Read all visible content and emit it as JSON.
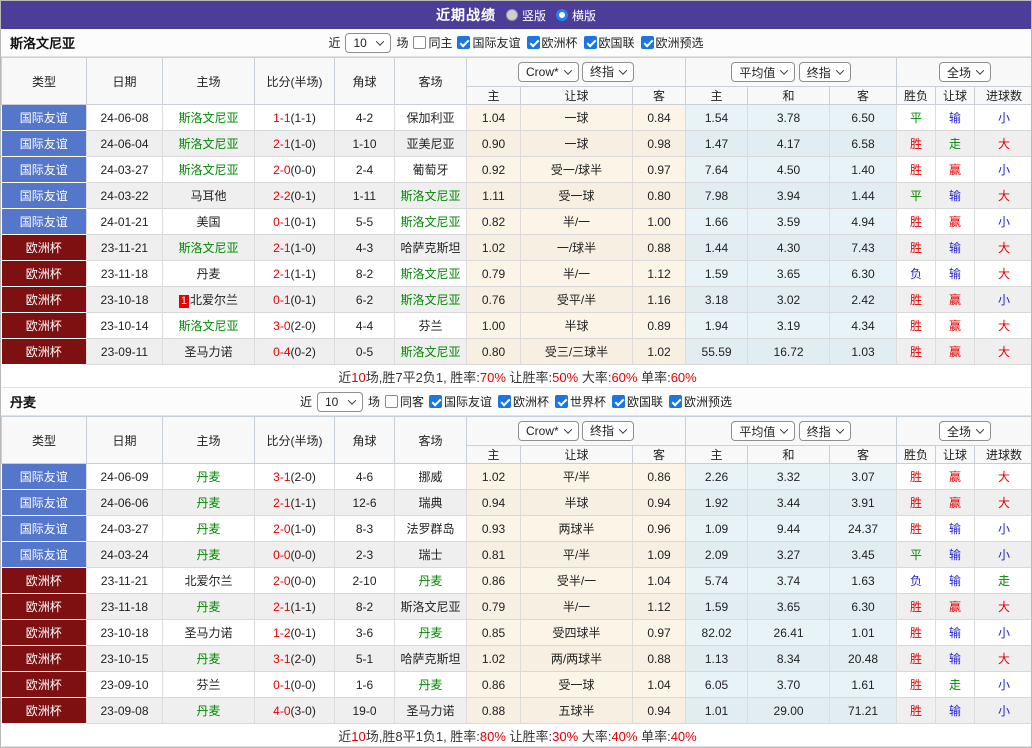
{
  "topbar": {
    "title": "近期战绩",
    "layout_options": [
      {
        "label": "竖版",
        "selected": false
      },
      {
        "label": "横版",
        "selected": true
      }
    ]
  },
  "colors": {
    "accent_purple": "#4b3d98",
    "badge_blue": "#5577cb",
    "badge_maroon": "#7e1012",
    "win_red": "#e60000",
    "loss_blue": "#2525cc",
    "draw_green": "#008800",
    "crow_column_bg": "#fbf4e7",
    "avg_column_bg": "#e8f3f7"
  },
  "table_header": {
    "static_cols": [
      "类型",
      "日期",
      "主场",
      "比分(半场)",
      "角球",
      "客场"
    ],
    "crow_group": {
      "select1": "Crow*",
      "select2": "终指",
      "sub": [
        "主",
        "让球",
        "客"
      ]
    },
    "avg_group": {
      "select1": "平均值",
      "select2": "终指",
      "sub": [
        "主",
        "和",
        "客"
      ]
    },
    "full_group": {
      "select": "全场",
      "sub": [
        "胜负",
        "让球",
        "进球数"
      ]
    }
  },
  "sections": [
    {
      "team": "斯洛文尼亚",
      "filter": {
        "prefix": "近",
        "count": "10",
        "suffix": "场",
        "same_venue_label": "同主",
        "same_venue_checked": false,
        "leagues": [
          "国际友谊",
          "欧洲杯",
          "欧国联",
          "欧洲预选"
        ]
      },
      "rows": [
        {
          "type": "国际友谊",
          "type_color": "blue",
          "date": "24-06-08",
          "home": "斯洛文尼亚",
          "home_green": true,
          "home_badge": "",
          "score": "1-1",
          "half": "(1-1)",
          "corner": "4-2",
          "away": "保加利亚",
          "away_green": false,
          "crow_home": "1.04",
          "handicap": "一球",
          "crow_away": "0.84",
          "avg_home": "1.54",
          "avg_draw": "3.78",
          "avg_away": "6.50",
          "result": "平",
          "result_c": "green",
          "hresult": "输",
          "hresult_c": "blue",
          "goals": "小",
          "goals_c": "blue"
        },
        {
          "type": "国际友谊",
          "type_color": "blue",
          "date": "24-06-04",
          "home": "斯洛文尼亚",
          "home_green": true,
          "home_badge": "",
          "score": "2-1",
          "half": "(1-0)",
          "corner": "1-10",
          "away": "亚美尼亚",
          "away_green": false,
          "crow_home": "0.90",
          "handicap": "一球",
          "crow_away": "0.98",
          "avg_home": "1.47",
          "avg_draw": "4.17",
          "avg_away": "6.58",
          "result": "胜",
          "result_c": "red",
          "hresult": "走",
          "hresult_c": "green",
          "goals": "大",
          "goals_c": "red"
        },
        {
          "type": "国际友谊",
          "type_color": "blue",
          "date": "24-03-27",
          "home": "斯洛文尼亚",
          "home_green": true,
          "home_badge": "",
          "score": "2-0",
          "half": "(0-0)",
          "corner": "2-4",
          "away": "葡萄牙",
          "away_green": false,
          "crow_home": "0.92",
          "handicap": "受一/球半",
          "crow_away": "0.97",
          "avg_home": "7.64",
          "avg_draw": "4.50",
          "avg_away": "1.40",
          "result": "胜",
          "result_c": "red",
          "hresult": "赢",
          "hresult_c": "red",
          "goals": "小",
          "goals_c": "blue"
        },
        {
          "type": "国际友谊",
          "type_color": "blue",
          "date": "24-03-22",
          "home": "马耳他",
          "home_green": false,
          "home_badge": "",
          "score": "2-2",
          "half": "(0-1)",
          "corner": "1-11",
          "away": "斯洛文尼亚",
          "away_green": true,
          "crow_home": "1.11",
          "handicap": "受一球",
          "crow_away": "0.80",
          "avg_home": "7.98",
          "avg_draw": "3.94",
          "avg_away": "1.44",
          "result": "平",
          "result_c": "green",
          "hresult": "输",
          "hresult_c": "blue",
          "goals": "大",
          "goals_c": "red"
        },
        {
          "type": "国际友谊",
          "type_color": "blue",
          "date": "24-01-21",
          "home": "美国",
          "home_green": false,
          "home_badge": "",
          "score": "0-1",
          "half": "(0-1)",
          "corner": "5-5",
          "away": "斯洛文尼亚",
          "away_green": true,
          "crow_home": "0.82",
          "handicap": "半/一",
          "crow_away": "1.00",
          "avg_home": "1.66",
          "avg_draw": "3.59",
          "avg_away": "4.94",
          "result": "胜",
          "result_c": "red",
          "hresult": "赢",
          "hresult_c": "red",
          "goals": "小",
          "goals_c": "blue"
        },
        {
          "type": "欧洲杯",
          "type_color": "maroon",
          "date": "23-11-21",
          "home": "斯洛文尼亚",
          "home_green": true,
          "home_badge": "",
          "score": "2-1",
          "half": "(1-0)",
          "corner": "4-3",
          "away": "哈萨克斯坦",
          "away_green": false,
          "crow_home": "1.02",
          "handicap": "一/球半",
          "crow_away": "0.88",
          "avg_home": "1.44",
          "avg_draw": "4.30",
          "avg_away": "7.43",
          "result": "胜",
          "result_c": "red",
          "hresult": "输",
          "hresult_c": "blue",
          "goals": "大",
          "goals_c": "red"
        },
        {
          "type": "欧洲杯",
          "type_color": "maroon",
          "date": "23-11-18",
          "home": "丹麦",
          "home_green": false,
          "home_badge": "",
          "score": "2-1",
          "half": "(1-1)",
          "corner": "8-2",
          "away": "斯洛文尼亚",
          "away_green": true,
          "crow_home": "0.79",
          "handicap": "半/一",
          "crow_away": "1.12",
          "avg_home": "1.59",
          "avg_draw": "3.65",
          "avg_away": "6.30",
          "result": "负",
          "result_c": "blue",
          "hresult": "输",
          "hresult_c": "blue",
          "goals": "大",
          "goals_c": "red"
        },
        {
          "type": "欧洲杯",
          "type_color": "maroon",
          "date": "23-10-18",
          "home": "北爱尔兰",
          "home_green": false,
          "home_badge": "1",
          "score": "0-1",
          "half": "(0-1)",
          "corner": "6-2",
          "away": "斯洛文尼亚",
          "away_green": true,
          "crow_home": "0.76",
          "handicap": "受平/半",
          "crow_away": "1.16",
          "avg_home": "3.18",
          "avg_draw": "3.02",
          "avg_away": "2.42",
          "result": "胜",
          "result_c": "red",
          "hresult": "赢",
          "hresult_c": "red",
          "goals": "小",
          "goals_c": "blue"
        },
        {
          "type": "欧洲杯",
          "type_color": "maroon",
          "date": "23-10-14",
          "home": "斯洛文尼亚",
          "home_green": true,
          "home_badge": "",
          "score": "3-0",
          "half": "(2-0)",
          "corner": "4-4",
          "away": "芬兰",
          "away_green": false,
          "crow_home": "1.00",
          "handicap": "半球",
          "crow_away": "0.89",
          "avg_home": "1.94",
          "avg_draw": "3.19",
          "avg_away": "4.34",
          "result": "胜",
          "result_c": "red",
          "hresult": "赢",
          "hresult_c": "red",
          "goals": "大",
          "goals_c": "red"
        },
        {
          "type": "欧洲杯",
          "type_color": "maroon",
          "date": "23-09-11",
          "home": "圣马力诺",
          "home_green": false,
          "home_badge": "",
          "score": "0-4",
          "half": "(0-2)",
          "corner": "0-5",
          "away": "斯洛文尼亚",
          "away_green": true,
          "crow_home": "0.80",
          "handicap": "受三/三球半",
          "crow_away": "1.02",
          "avg_home": "55.59",
          "avg_draw": "16.72",
          "avg_away": "1.03",
          "result": "胜",
          "result_c": "red",
          "hresult": "赢",
          "hresult_c": "red",
          "goals": "大",
          "goals_c": "red"
        }
      ],
      "summary": [
        {
          "t": "近"
        },
        {
          "t": "10",
          "red": true
        },
        {
          "t": "场,胜7平2负1, 胜率:"
        },
        {
          "t": "70%",
          "red": true
        },
        {
          "t": " 让胜率:"
        },
        {
          "t": "50%",
          "red": true
        },
        {
          "t": " 大率:"
        },
        {
          "t": "60%",
          "red": true
        },
        {
          "t": " 单率:"
        },
        {
          "t": "60%",
          "red": true
        }
      ]
    },
    {
      "team": "丹麦",
      "filter": {
        "prefix": "近",
        "count": "10",
        "suffix": "场",
        "same_venue_label": "同客",
        "same_venue_checked": false,
        "leagues": [
          "国际友谊",
          "欧洲杯",
          "世界杯",
          "欧国联",
          "欧洲预选"
        ]
      },
      "rows": [
        {
          "type": "国际友谊",
          "type_color": "blue",
          "date": "24-06-09",
          "home": "丹麦",
          "home_green": true,
          "home_badge": "",
          "score": "3-1",
          "half": "(2-0)",
          "corner": "4-6",
          "away": "挪威",
          "away_green": false,
          "crow_home": "1.02",
          "handicap": "平/半",
          "crow_away": "0.86",
          "avg_home": "2.26",
          "avg_draw": "3.32",
          "avg_away": "3.07",
          "result": "胜",
          "result_c": "red",
          "hresult": "赢",
          "hresult_c": "red",
          "goals": "大",
          "goals_c": "red"
        },
        {
          "type": "国际友谊",
          "type_color": "blue",
          "date": "24-06-06",
          "home": "丹麦",
          "home_green": true,
          "home_badge": "",
          "score": "2-1",
          "half": "(1-1)",
          "corner": "12-6",
          "away": "瑞典",
          "away_green": false,
          "crow_home": "0.94",
          "handicap": "半球",
          "crow_away": "0.94",
          "avg_home": "1.92",
          "avg_draw": "3.44",
          "avg_away": "3.91",
          "result": "胜",
          "result_c": "red",
          "hresult": "赢",
          "hresult_c": "red",
          "goals": "大",
          "goals_c": "red"
        },
        {
          "type": "国际友谊",
          "type_color": "blue",
          "date": "24-03-27",
          "home": "丹麦",
          "home_green": true,
          "home_badge": "",
          "score": "2-0",
          "half": "(1-0)",
          "corner": "8-3",
          "away": "法罗群岛",
          "away_green": false,
          "crow_home": "0.93",
          "handicap": "两球半",
          "crow_away": "0.96",
          "avg_home": "1.09",
          "avg_draw": "9.44",
          "avg_away": "24.37",
          "result": "胜",
          "result_c": "red",
          "hresult": "输",
          "hresult_c": "blue",
          "goals": "小",
          "goals_c": "blue"
        },
        {
          "type": "国际友谊",
          "type_color": "blue",
          "date": "24-03-24",
          "home": "丹麦",
          "home_green": true,
          "home_badge": "",
          "score": "0-0",
          "half": "(0-0)",
          "corner": "2-3",
          "away": "瑞士",
          "away_green": false,
          "crow_home": "0.81",
          "handicap": "平/半",
          "crow_away": "1.09",
          "avg_home": "2.09",
          "avg_draw": "3.27",
          "avg_away": "3.45",
          "result": "平",
          "result_c": "green",
          "hresult": "输",
          "hresult_c": "blue",
          "goals": "小",
          "goals_c": "blue"
        },
        {
          "type": "欧洲杯",
          "type_color": "maroon",
          "date": "23-11-21",
          "home": "北爱尔兰",
          "home_green": false,
          "home_badge": "",
          "score": "2-0",
          "half": "(0-0)",
          "corner": "2-10",
          "away": "丹麦",
          "away_green": true,
          "crow_home": "0.86",
          "handicap": "受半/一",
          "crow_away": "1.04",
          "avg_home": "5.74",
          "avg_draw": "3.74",
          "avg_away": "1.63",
          "result": "负",
          "result_c": "blue",
          "hresult": "输",
          "hresult_c": "blue",
          "goals": "走",
          "goals_c": "green"
        },
        {
          "type": "欧洲杯",
          "type_color": "maroon",
          "date": "23-11-18",
          "home": "丹麦",
          "home_green": true,
          "home_badge": "",
          "score": "2-1",
          "half": "(1-1)",
          "corner": "8-2",
          "away": "斯洛文尼亚",
          "away_green": false,
          "crow_home": "0.79",
          "handicap": "半/一",
          "crow_away": "1.12",
          "avg_home": "1.59",
          "avg_draw": "3.65",
          "avg_away": "6.30",
          "result": "胜",
          "result_c": "red",
          "hresult": "赢",
          "hresult_c": "red",
          "goals": "大",
          "goals_c": "red"
        },
        {
          "type": "欧洲杯",
          "type_color": "maroon",
          "date": "23-10-18",
          "home": "圣马力诺",
          "home_green": false,
          "home_badge": "",
          "score": "1-2",
          "half": "(0-1)",
          "corner": "3-6",
          "away": "丹麦",
          "away_green": true,
          "crow_home": "0.85",
          "handicap": "受四球半",
          "crow_away": "0.97",
          "avg_home": "82.02",
          "avg_draw": "26.41",
          "avg_away": "1.01",
          "result": "胜",
          "result_c": "red",
          "hresult": "输",
          "hresult_c": "blue",
          "goals": "小",
          "goals_c": "blue"
        },
        {
          "type": "欧洲杯",
          "type_color": "maroon",
          "date": "23-10-15",
          "home": "丹麦",
          "home_green": true,
          "home_badge": "",
          "score": "3-1",
          "half": "(2-0)",
          "corner": "5-1",
          "away": "哈萨克斯坦",
          "away_green": false,
          "crow_home": "1.02",
          "handicap": "两/两球半",
          "crow_away": "0.88",
          "avg_home": "1.13",
          "avg_draw": "8.34",
          "avg_away": "20.48",
          "result": "胜",
          "result_c": "red",
          "hresult": "输",
          "hresult_c": "blue",
          "goals": "大",
          "goals_c": "red"
        },
        {
          "type": "欧洲杯",
          "type_color": "maroon",
          "date": "23-09-10",
          "home": "芬兰",
          "home_green": false,
          "home_badge": "",
          "score": "0-1",
          "half": "(0-0)",
          "corner": "1-6",
          "away": "丹麦",
          "away_green": true,
          "crow_home": "0.86",
          "handicap": "受一球",
          "crow_away": "1.04",
          "avg_home": "6.05",
          "avg_draw": "3.70",
          "avg_away": "1.61",
          "result": "胜",
          "result_c": "red",
          "hresult": "走",
          "hresult_c": "green",
          "goals": "小",
          "goals_c": "blue"
        },
        {
          "type": "欧洲杯",
          "type_color": "maroon",
          "date": "23-09-08",
          "home": "丹麦",
          "home_green": true,
          "home_badge": "",
          "score": "4-0",
          "half": "(3-0)",
          "corner": "19-0",
          "away": "圣马力诺",
          "away_green": false,
          "crow_home": "0.88",
          "handicap": "五球半",
          "crow_away": "0.94",
          "avg_home": "1.01",
          "avg_draw": "29.00",
          "avg_away": "71.21",
          "result": "胜",
          "result_c": "red",
          "hresult": "输",
          "hresult_c": "blue",
          "goals": "小",
          "goals_c": "blue"
        }
      ],
      "summary": [
        {
          "t": "近"
        },
        {
          "t": "10",
          "red": true
        },
        {
          "t": "场,胜8平1负1, 胜率:"
        },
        {
          "t": "80%",
          "red": true
        },
        {
          "t": " 让胜率:"
        },
        {
          "t": "30%",
          "red": true
        },
        {
          "t": " 大率:"
        },
        {
          "t": "40%",
          "red": true
        },
        {
          "t": " 单率:"
        },
        {
          "t": "40%",
          "red": true
        }
      ]
    }
  ]
}
